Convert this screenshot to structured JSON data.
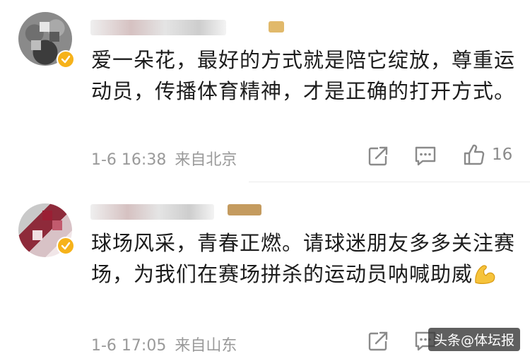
{
  "comments": [
    {
      "text": "爱一朵花，最好的方式就是陪它绽放，尊重运动员，传播体育精神，才是正确的打开方式。",
      "time": "1-6 16:38",
      "location": "来自北京",
      "likes": "16",
      "icons": [
        "share-icon",
        "comment-icon",
        "like-icon"
      ]
    },
    {
      "text": "球场风采，青春正燃。请球迷朋友多多关注赛场，为我们在赛场拼杀的运动员呐喊助威",
      "emoji": "flexed-biceps-emoji",
      "time": "1-6 17:05",
      "location": "来自山东",
      "icons": [
        "share-icon",
        "comment-icon"
      ]
    }
  ],
  "watermark": "头条@体坛报",
  "colors": {
    "text": "#1c1c1c",
    "meta": "#9a9a9a",
    "verified": "#f6b21a"
  }
}
